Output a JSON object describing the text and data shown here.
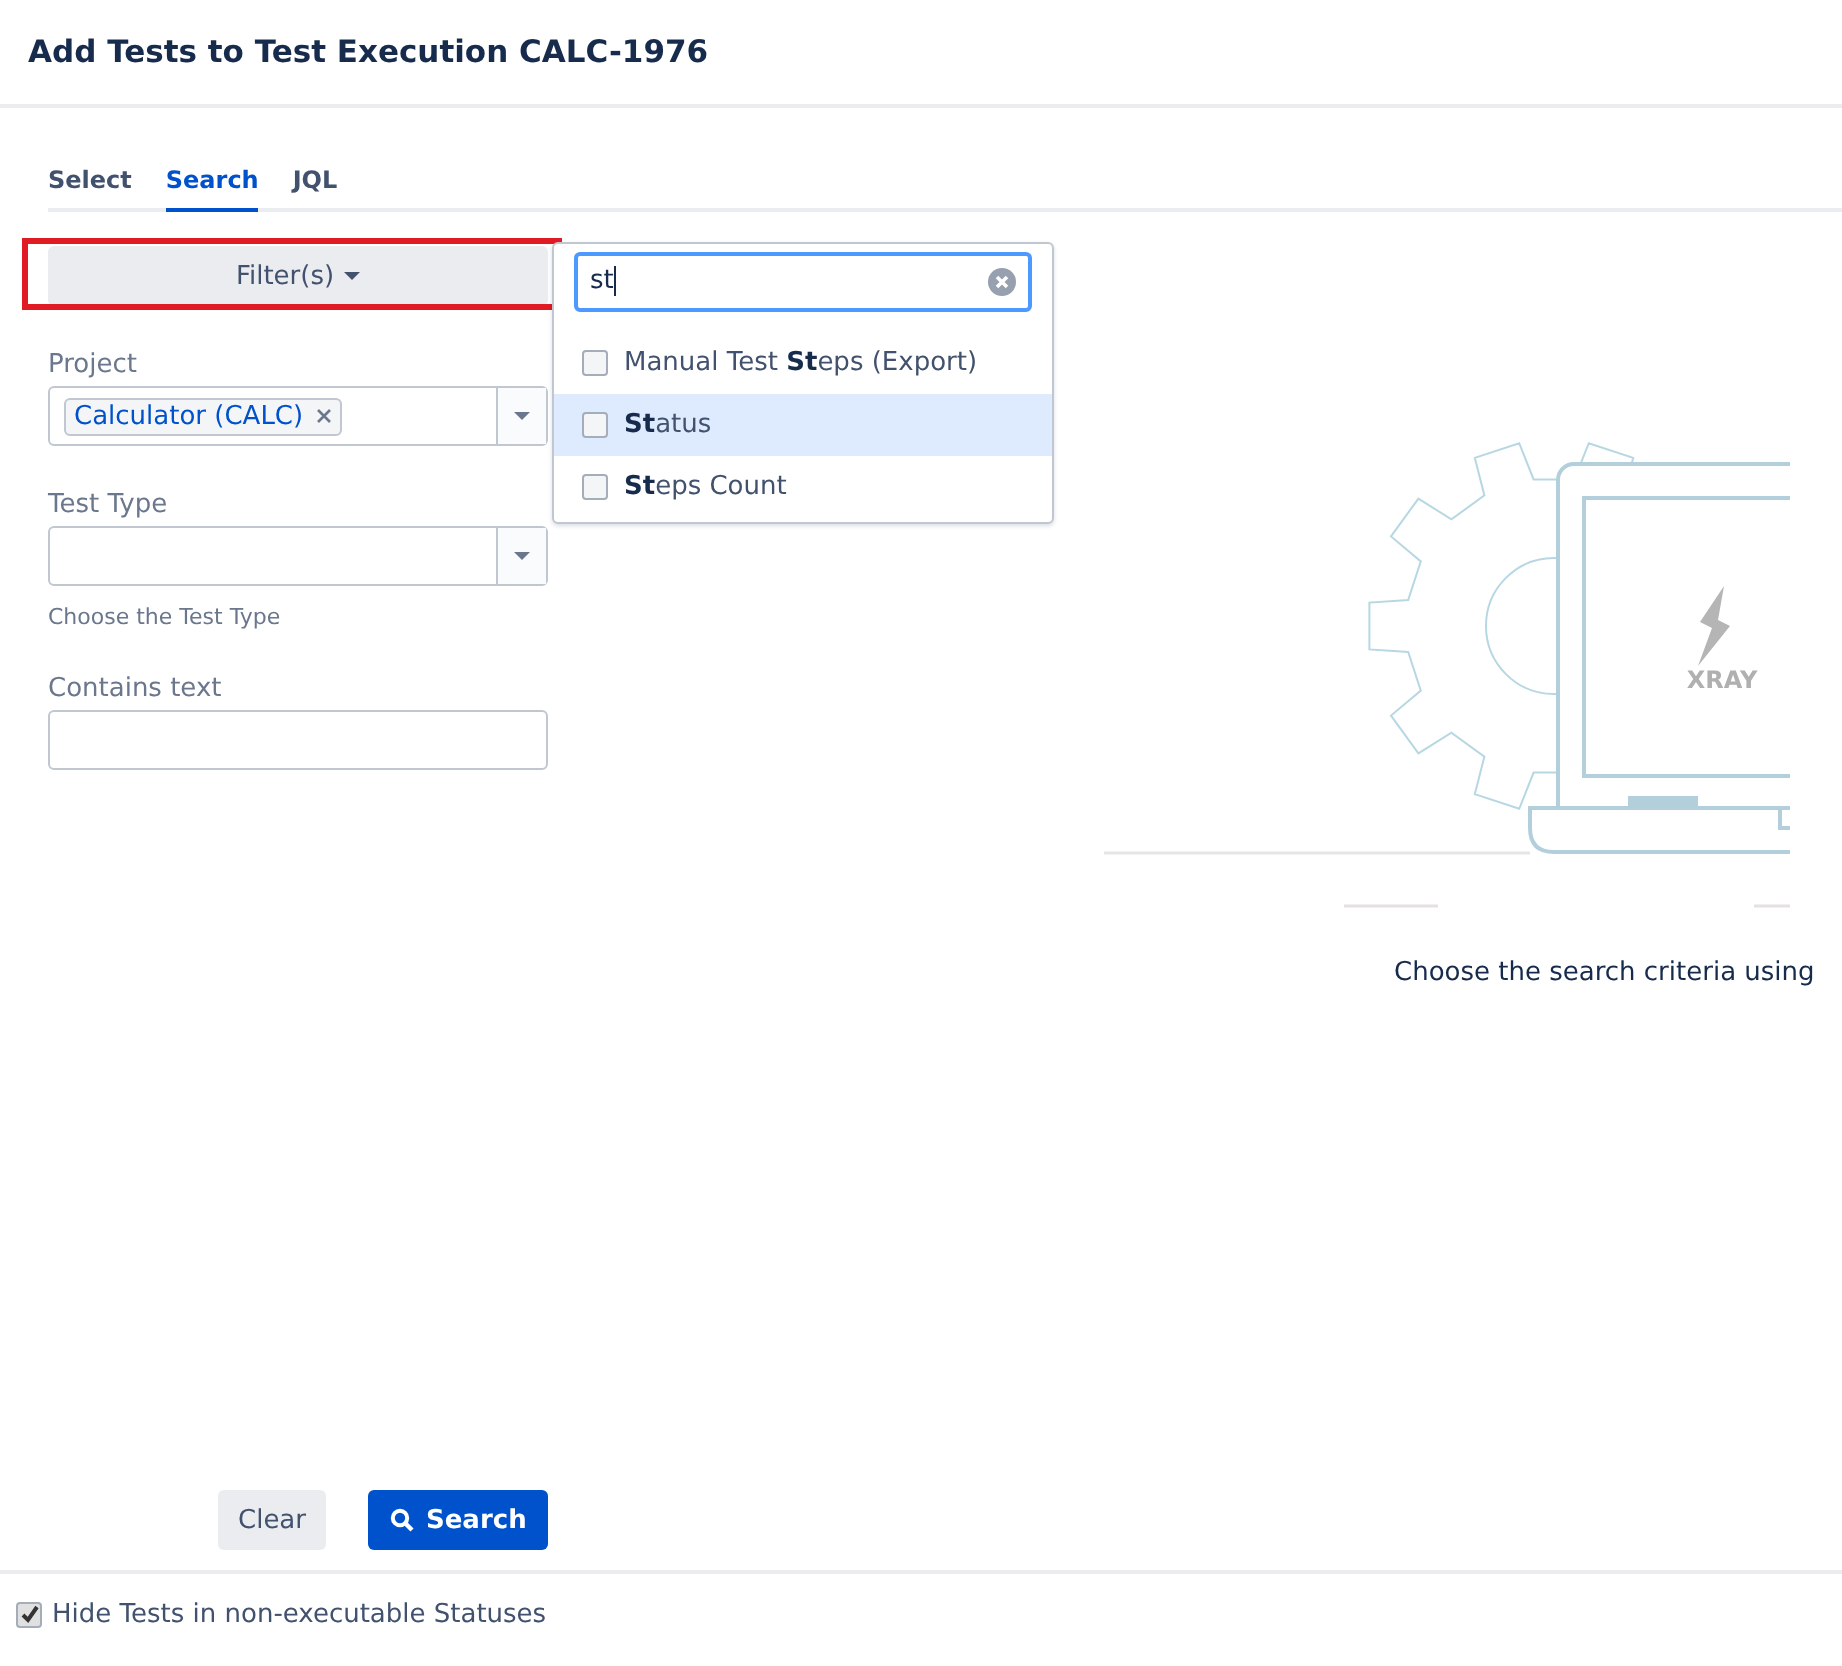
{
  "dialog": {
    "title": "Add Tests to Test Execution CALC-1976"
  },
  "tabs": [
    {
      "label": "Select",
      "selected": false
    },
    {
      "label": "Search",
      "selected": true
    },
    {
      "label": "JQL",
      "selected": false
    }
  ],
  "filter_button": {
    "label": "Filter(s)",
    "highlighted": true
  },
  "filter_dropdown": {
    "search_value": "st",
    "options": [
      {
        "label": "Manual Test **St**eps (Export)",
        "checked": false,
        "selected": false
      },
      {
        "label": "**St**atus",
        "checked": false,
        "selected": true
      },
      {
        "label": "**St**eps Count",
        "checked": false,
        "selected": false
      }
    ]
  },
  "fields": [
    {
      "kind": "select",
      "label": "Project",
      "tags": [
        "Calculator (CALC)"
      ]
    },
    {
      "kind": "select",
      "label": "Test Type",
      "help": "Choose the Test Type"
    },
    {
      "kind": "text",
      "label": "Contains text"
    }
  ],
  "empty_state": {
    "logo_text": "XRAY",
    "message": "Choose the search criteria using"
  },
  "buttons": [
    {
      "label": "Clear",
      "kind": "secondary"
    },
    {
      "label": "Search",
      "kind": "primary"
    }
  ],
  "footer": {
    "checkbox_label": "Hide Tests in non-executable Statuses",
    "checked": true
  }
}
